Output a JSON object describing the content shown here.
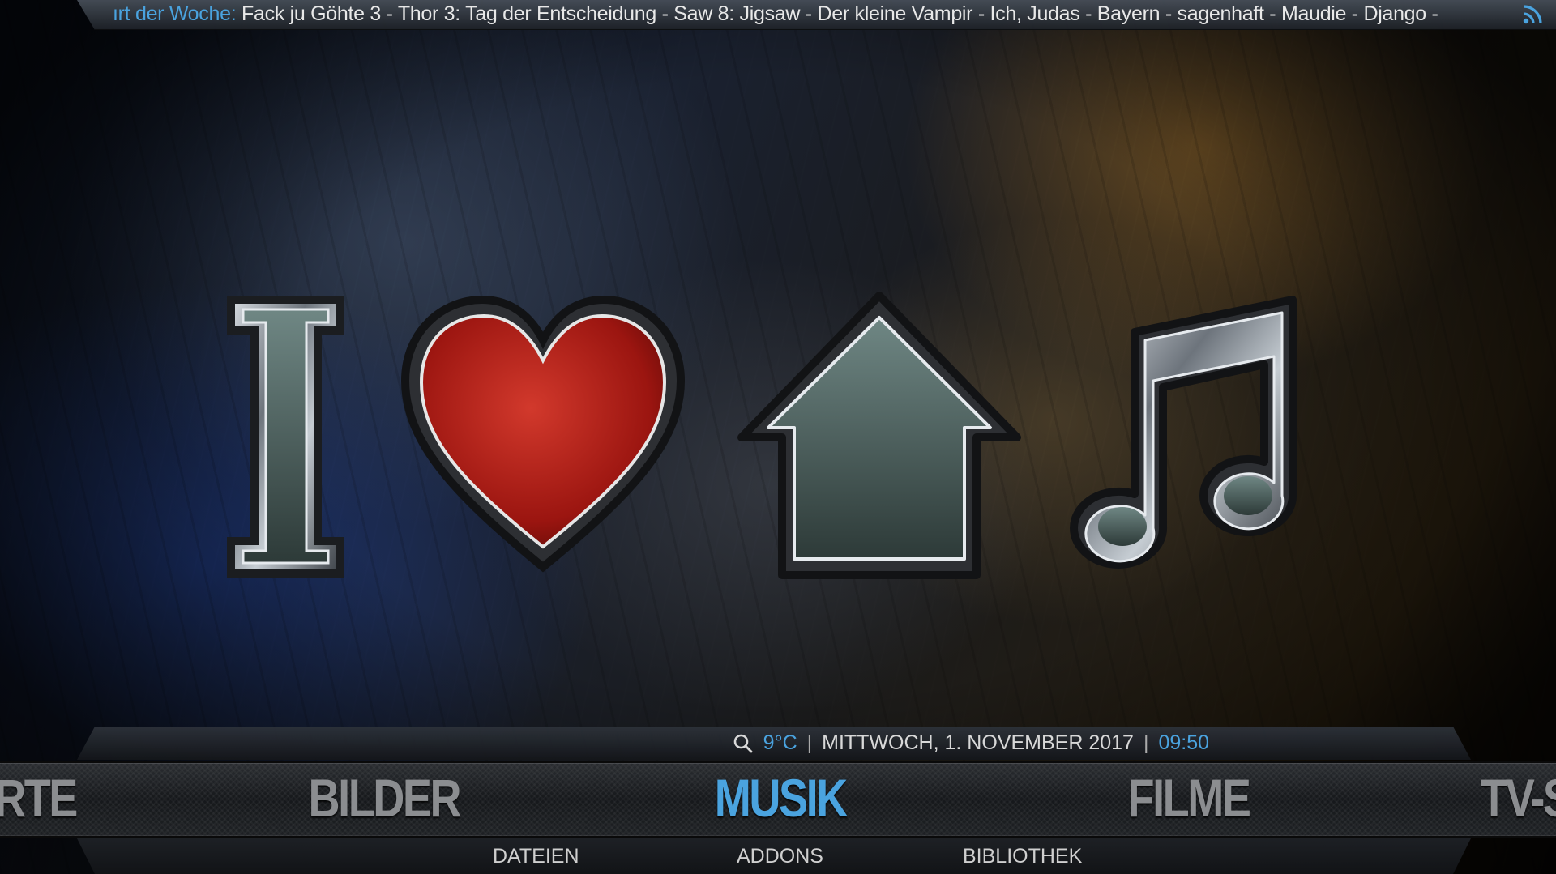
{
  "ticker": {
    "prefix": "ırt der Woche:",
    "text": " Fack ju Göhte 3 - Thor 3: Tag der Entscheidung - Saw 8: Jigsaw - Der kleine Vampir - Ich, Judas - Bayern - sagenhaft - Maudie - Django -",
    "icon": "rss-icon"
  },
  "info_bar": {
    "search_icon": "search-icon",
    "temperature": "9°C",
    "separator": "|",
    "date": "MITTWOCH, 1. NOVEMBER 2017",
    "time": "09:50"
  },
  "menu": {
    "items": [
      {
        "label": "RTE",
        "active": false
      },
      {
        "label": "BILDER",
        "active": false
      },
      {
        "label": "MUSIK",
        "active": true
      },
      {
        "label": "FILME",
        "active": false
      },
      {
        "label": "TV-S",
        "active": false
      }
    ]
  },
  "submenu": {
    "items": [
      "DATEIEN",
      "ADDONS",
      "BIBLIOTHEK"
    ]
  },
  "artwork": {
    "description_icons": [
      "letter-i-icon",
      "heart-icon",
      "house-icon",
      "music-note-icon"
    ]
  },
  "colors": {
    "accent": "#4aa3df",
    "menu_inactive": "#8b8d90",
    "heart": "#a01818"
  }
}
